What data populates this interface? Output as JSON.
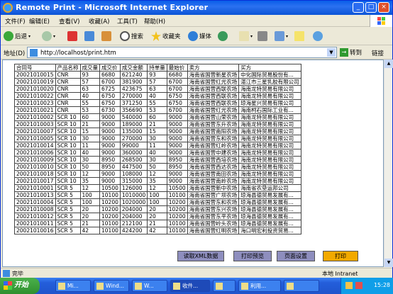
{
  "window": {
    "title": "Remote Print - Microsoft Internet Explorer"
  },
  "menu": [
    "文件(F)",
    "编辑(E)",
    "查看(V)",
    "收藏(A)",
    "工具(T)",
    "帮助(H)"
  ],
  "toolbar": {
    "back": "后退",
    "search": "搜索",
    "favorites": "收藏夹",
    "media": "媒体"
  },
  "address": {
    "label": "地址(D)",
    "url": "http://localhost/print.htm",
    "go": "转到",
    "links": "链接"
  },
  "table": {
    "headers": [
      "合同号",
      "产品名称",
      "成交量",
      "成交价",
      "成交金额",
      "持单量",
      "最始价",
      "卖方",
      "买方"
    ],
    "rows": [
      [
        "20021010015",
        "CNR",
        "93",
        "6680",
        "621240",
        "93",
        "6680",
        "海南省国营新星农场",
        "中化国际贸易股份有..."
      ],
      [
        "20021010019",
        "CNR",
        "57",
        "6700",
        "381900",
        "57",
        "6700",
        "海南省国营红光农场",
        "湛江市三星乳胶有限公司"
      ],
      [
        "20021010020",
        "CNR",
        "63",
        "6725",
        "423675",
        "63",
        "6700",
        "海南省国营西联农场",
        "海南龙特贸易有限公司"
      ],
      [
        "20021010022",
        "CNR",
        "40",
        "6750",
        "270000",
        "40",
        "6750",
        "海南省国营西联农场",
        "海南龙特贸易有限公司"
      ],
      [
        "20021010023",
        "CNR",
        "55",
        "6750",
        "371250",
        "55",
        "6750",
        "海南省国营西联农场",
        "琼海星兴贸易有限公司"
      ],
      [
        "20021010021",
        "CNR",
        "53",
        "6730",
        "356690",
        "53",
        "6700",
        "海南省国营红光农场",
        "海南柯石国际工业有..."
      ],
      [
        "20021010002",
        "SCR 10",
        "60",
        "9000",
        "540000",
        "60",
        "9000",
        "海南省国营山荣农场",
        "海南龙特贸易有限公司"
      ],
      [
        "20021010003",
        "SCR 10",
        "21",
        "9000",
        "189000",
        "21",
        "9000",
        "海南省国营东升农场",
        "海南龙特贸易有限公司"
      ],
      [
        "20021010007",
        "SCR 10",
        "15",
        "9000",
        "135000",
        "15",
        "9000",
        "海南省国营南阳农场",
        "海南龙特贸易有限公司"
      ],
      [
        "20021010005",
        "SCR 10",
        "30",
        "9000",
        "270000",
        "30",
        "9000",
        "海南省国营东和农场",
        "海南龙特贸易有限公司"
      ],
      [
        "20021010014",
        "SCR 10",
        "11",
        "9000",
        "99000",
        "11",
        "9000",
        "海南省国营红岭农场",
        "海南龙特贸易有限公司"
      ],
      [
        "20021010006",
        "SCR 10",
        "40",
        "9000",
        "360000",
        "40",
        "9000",
        "海南省国营中建农场",
        "海南龙特贸易有限公司"
      ],
      [
        "20021010009",
        "SCR 10",
        "30",
        "8950",
        "268500",
        "30",
        "8950",
        "海南省国营西培农场",
        "海南龙特贸易有限公司"
      ],
      [
        "20021010010",
        "SCR 10",
        "50",
        "8950",
        "447500",
        "50",
        "8950",
        "海南省国营西达农场",
        "海南龙特贸易有限公司"
      ],
      [
        "20021010018",
        "SCR 10",
        "12",
        "9000",
        "108000",
        "12",
        "9000",
        "海南省国营南田农场",
        "海南龙特贸易有限公司"
      ],
      [
        "20021010017",
        "SCR 10",
        "35",
        "9000",
        "315000",
        "35",
        "9000",
        "海南省国营南岭农场",
        "海南龙特贸易有限公司"
      ],
      [
        "20021010001",
        "SCR 5",
        "12",
        "10500",
        "126000",
        "12",
        "10500",
        "海南省国营新中农场",
        "海南省农垦运邦公司"
      ],
      [
        "20021010013",
        "SCR 5",
        "100",
        "10100",
        "1010000",
        "100",
        "10100",
        "海南省国营广坝农场",
        "琼海县德贸易发展有..."
      ],
      [
        "20021010004",
        "SCR 5",
        "100",
        "10200",
        "1020000",
        "100",
        "10200",
        "海南省国营东和农场",
        "琼海县德贸易发展有..."
      ],
      [
        "20021010008",
        "SCR 5",
        "20",
        "10200",
        "204000",
        "20",
        "10200",
        "海南省国营东兴农场",
        "琼海县德贸易发展有..."
      ],
      [
        "20021010012",
        "SCR 5",
        "20",
        "10200",
        "204000",
        "20",
        "10200",
        "海南省国营东平农场",
        "琼海县德贸易发展有..."
      ],
      [
        "20021010011",
        "SCR 5",
        "21",
        "10100",
        "212100",
        "21",
        "10100",
        "海南省国营岭头农场",
        "琼海县德贸易发展有..."
      ],
      [
        "20021010016",
        "SCR 5",
        "42",
        "10100",
        "424200",
        "42",
        "10100",
        "海南省国营红明农场",
        "海口明宏利投资贸易..."
      ]
    ]
  },
  "buttons": {
    "read": "读取XML数据",
    "preview": "打印预览",
    "setup": "页面设置",
    "print": "打印"
  },
  "status": {
    "done": "完毕",
    "zone": "本地 Intranet"
  },
  "taskbar": {
    "start": "开始",
    "tasks": [
      "Mi...",
      "Wind...",
      "W...",
      "收件...",
      "",
      "利用...",
      ""
    ],
    "clock": "15:28"
  },
  "colors": {
    "titlebar": "#0a5ee8",
    "action_button": "#8e8ebe",
    "print_button": "#f2a900"
  }
}
